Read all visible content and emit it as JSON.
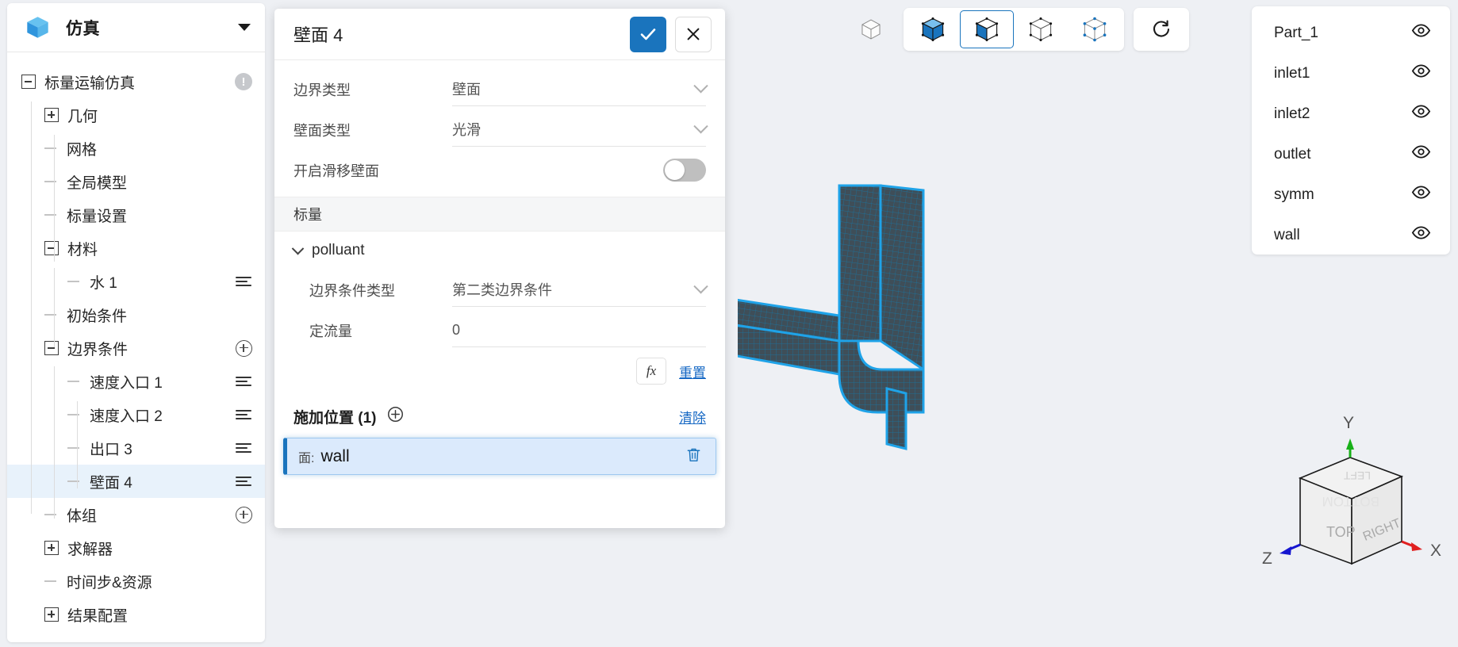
{
  "sidebar": {
    "logo_icon": "cube-logo-icon",
    "title": "仿真",
    "caret_icon": "chevron-down-icon",
    "tree": [
      {
        "label": "标量运输仿真",
        "toggle": "minus",
        "depth": 0,
        "action": "warn",
        "selected": false
      },
      {
        "label": "几何",
        "toggle": "plus",
        "depth": 1,
        "action": "none",
        "selected": false
      },
      {
        "label": "网格",
        "toggle": "dash",
        "depth": 1,
        "action": "none",
        "selected": false
      },
      {
        "label": "全局模型",
        "toggle": "dash",
        "depth": 1,
        "action": "none",
        "selected": false
      },
      {
        "label": "标量设置",
        "toggle": "dash",
        "depth": 1,
        "action": "none",
        "selected": false
      },
      {
        "label": "材料",
        "toggle": "minus",
        "depth": 1,
        "action": "none",
        "selected": false
      },
      {
        "label": "水 1",
        "toggle": "dash",
        "depth": 2,
        "action": "list",
        "selected": false
      },
      {
        "label": "初始条件",
        "toggle": "dash",
        "depth": 1,
        "action": "none",
        "selected": false
      },
      {
        "label": "边界条件",
        "toggle": "minus",
        "depth": 1,
        "action": "plus",
        "selected": false
      },
      {
        "label": "速度入口 1",
        "toggle": "dash",
        "depth": 2,
        "action": "list",
        "selected": false
      },
      {
        "label": "速度入口 2",
        "toggle": "dash",
        "depth": 2,
        "action": "list",
        "selected": false
      },
      {
        "label": "出口 3",
        "toggle": "dash",
        "depth": 2,
        "action": "list",
        "selected": false
      },
      {
        "label": "壁面 4",
        "toggle": "dash",
        "depth": 2,
        "action": "list",
        "selected": true
      },
      {
        "label": "体组",
        "toggle": "dash",
        "depth": 1,
        "action": "plus",
        "selected": false
      },
      {
        "label": "求解器",
        "toggle": "plus",
        "depth": 1,
        "action": "none",
        "selected": false
      },
      {
        "label": "时间步&资源",
        "toggle": "dash",
        "depth": 1,
        "action": "none",
        "selected": false
      },
      {
        "label": "结果配置",
        "toggle": "plus",
        "depth": 1,
        "action": "none",
        "selected": false
      }
    ]
  },
  "dialog": {
    "title": "壁面 4",
    "confirm_icon": "check-icon",
    "close_icon": "close-icon",
    "fields": [
      {
        "label": "边界类型",
        "value": "壁面",
        "control": "select"
      },
      {
        "label": "壁面类型",
        "value": "光滑",
        "control": "select"
      }
    ],
    "slip_wall": {
      "label": "开启滑移壁面",
      "enabled": false
    },
    "scalar_section": {
      "band_label": "标量",
      "group_label": "polluant",
      "group_chevron": "chevron-down-icon"
    },
    "scalar_fields": [
      {
        "label": "边界条件类型",
        "value": "第二类边界条件",
        "control": "select"
      },
      {
        "label": "定流量",
        "value": "0",
        "control": "input"
      }
    ],
    "fx_button": "fx",
    "reset_link": "重置",
    "position": {
      "title": "施加位置 (1)",
      "add_icon": "plus-circle-icon",
      "clear_link": "清除",
      "items": [
        {
          "kind": "面:",
          "name": "wall",
          "delete_icon": "trash-icon"
        }
      ]
    }
  },
  "toolbar": {
    "buttons": [
      {
        "name": "fit-view-icon",
        "style": "outline-cube",
        "grouped": false,
        "active": false
      },
      {
        "name": "view-solid-icon",
        "style": "solid-cube",
        "grouped": true,
        "active": false
      },
      {
        "name": "view-surface-icon",
        "style": "half-cube",
        "grouped": true,
        "active": true
      },
      {
        "name": "view-wireframe-icon",
        "style": "wire-cube",
        "grouped": true,
        "active": false
      },
      {
        "name": "view-points-icon",
        "style": "point-cube",
        "grouped": true,
        "active": false
      },
      {
        "name": "reset-view-icon",
        "style": "rotate",
        "grouped": false,
        "active": false
      }
    ]
  },
  "part_list": {
    "items": [
      {
        "label": "Part_1",
        "visibility_icon": "eye-icon"
      },
      {
        "label": "inlet1",
        "visibility_icon": "eye-icon"
      },
      {
        "label": "inlet2",
        "visibility_icon": "eye-icon"
      },
      {
        "label": "outlet",
        "visibility_icon": "eye-icon"
      },
      {
        "label": "symm",
        "visibility_icon": "eye-icon"
      },
      {
        "label": "wall",
        "visibility_icon": "eye-icon"
      }
    ]
  },
  "gizmo": {
    "axes": [
      {
        "label": "X",
        "color": "#e02020"
      },
      {
        "label": "Y",
        "color": "#18b018"
      },
      {
        "label": "Z",
        "color": "#1515d0"
      }
    ],
    "faces": [
      "TOP",
      "RIGHT",
      "LEFT",
      "BOTTOM"
    ]
  },
  "colors": {
    "accent": "#1a74bd",
    "selection_bg": "#dbeafc",
    "mesh_edge": "#1fa3e8",
    "mesh_fill": "#3d4c55",
    "canvas_bg": "#eef0f4"
  }
}
